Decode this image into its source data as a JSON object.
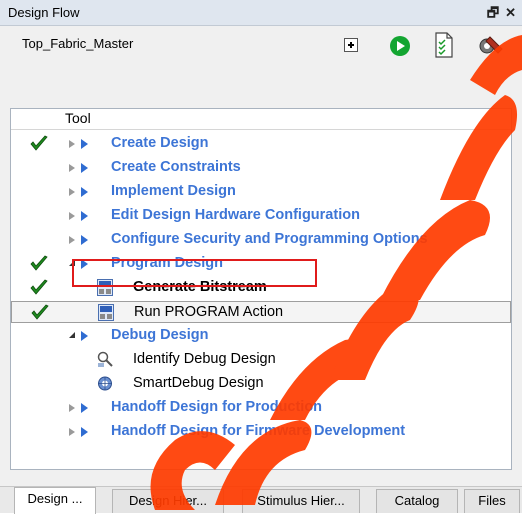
{
  "window": {
    "title": "Design Flow",
    "controls": [
      "restore-icon",
      "close-icon"
    ]
  },
  "project": {
    "name": "Top_Fabric_Master"
  },
  "toolbar": {
    "icons": [
      "expand-all-icon",
      "run-icon",
      "report-icon",
      "tool-options-icon"
    ]
  },
  "tree": {
    "header": "Tool",
    "items": [
      {
        "label": "Create Design",
        "checked": true
      },
      {
        "label": "Create Constraints",
        "checked": false
      },
      {
        "label": "Implement Design",
        "checked": false
      },
      {
        "label": "Edit Design Hardware Configuration",
        "checked": false
      },
      {
        "label": "Configure Security and Programming Options",
        "checked": false
      },
      {
        "label": "Program Design",
        "checked": true
      },
      {
        "label": "Generate Bitstream",
        "checked": true
      },
      {
        "label": "Run PROGRAM Action",
        "checked": true
      },
      {
        "label": "Debug Design",
        "checked": false
      },
      {
        "label": "Identify Debug Design",
        "checked": false
      },
      {
        "label": "SmartDebug Design",
        "checked": false
      },
      {
        "label": "Handoff Design for Production",
        "checked": false
      },
      {
        "label": "Handoff Design for Firmware Development",
        "checked": false
      }
    ]
  },
  "tabs": [
    "Design ...",
    "Design Hier...",
    "Stimulus Hier...",
    "Catalog",
    "Files"
  ],
  "colors": {
    "link_blue": "#3d75d6",
    "check_green": "#1f8a1f",
    "highlight_red": "#e01b1b",
    "watermark": "#ff3b00"
  }
}
